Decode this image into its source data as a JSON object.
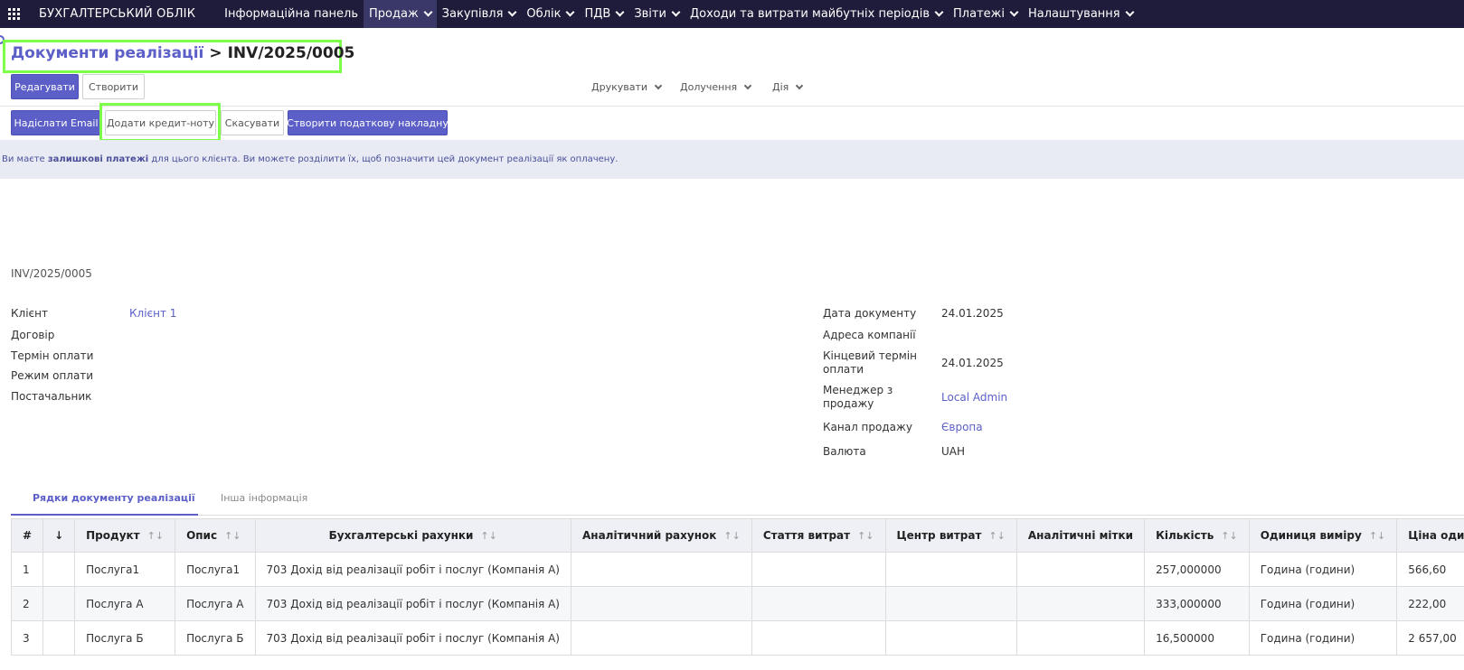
{
  "topbar": {
    "app_name": "БУХГАЛТЕРСЬКИЙ ОБЛІК",
    "items": [
      {
        "label": "Інформаційна панель",
        "dropdown": false
      },
      {
        "label": "Продаж",
        "dropdown": true,
        "active": true
      },
      {
        "label": "Закупівля",
        "dropdown": true
      },
      {
        "label": "Облік",
        "dropdown": true
      },
      {
        "label": "ПДВ",
        "dropdown": true
      },
      {
        "label": "Звіти",
        "dropdown": true
      },
      {
        "label": "Доходи та витрати майбутніх періодів",
        "dropdown": true
      },
      {
        "label": "Платежі",
        "dropdown": true
      },
      {
        "label": "Налаштування",
        "dropdown": true
      }
    ]
  },
  "breadcrumb": {
    "parent": "Документи реалізації",
    "separator": ">",
    "current": "INV/2025/0005"
  },
  "control": {
    "edit": "Редагувати",
    "create": "Створити",
    "print": "Друкувати",
    "attachments": "Долучення",
    "action": "Дія"
  },
  "statusbar": {
    "send_email": "Надіслати Email",
    "add_credit_note": "Додати кредит-ноту",
    "cancel": "Скасувати",
    "create_tax_invoice": "Створити податкову накладну"
  },
  "alert": {
    "prefix": "Ви маєте ",
    "bold": "залишкові платежі",
    "suffix": " для цього клієнта. Ви можете розділити їх, щоб позначити цей документ реалізації як оплачену."
  },
  "form": {
    "number": "INV/2025/0005",
    "left": {
      "client_label": "Клієнт",
      "client_value": "Клієнт 1",
      "contract_label": "Договір",
      "payment_terms_label": "Термін оплати",
      "payment_mode_label": "Режим оплати",
      "supplier_label": "Постачальник"
    },
    "right": {
      "doc_date_label": "Дата документу",
      "doc_date_value": "24.01.2025",
      "company_address_label": "Адреса компанії",
      "due_date_label_1": "Кінцевий термін",
      "due_date_label_2": "оплати",
      "due_date_value": "24.01.2025",
      "manager_label_1": "Менеджер з",
      "manager_label_2": "продажу",
      "manager_value": "Local Admin",
      "channel_label": "Канал продажу",
      "channel_value": "Європа",
      "currency_label": "Валюта",
      "currency_value": "UAH"
    }
  },
  "tabs": {
    "lines": "Рядки документу реалізації",
    "other": "Інша інформація"
  },
  "table": {
    "headers": {
      "num": "#",
      "sequence": "↓",
      "product": "Продукт",
      "description": "Опис",
      "accounts": "Бухгалтерські рахунки",
      "analytic_account": "Аналітичний рахунок",
      "expense_item": "Стаття витрат",
      "cost_center": "Центр витрат",
      "analytic_tags": "Аналітичні мітки",
      "quantity": "Кількість",
      "uom": "Одиниця виміру",
      "unit_price": "Ціна одиниці"
    },
    "sort_glyph": "↑↓",
    "rows": [
      {
        "num": "1",
        "product": "Послуга1",
        "description": "Послуга1",
        "account": "703 Дохід від реалізації робіт і послуг (Компанія А)",
        "qty": "257,000000",
        "uom": "Година (години)",
        "price": "566,60"
      },
      {
        "num": "2",
        "product": "Послуга А",
        "description": "Послуга А",
        "account": "703 Дохід від реалізації робіт і послуг (Компанія А)",
        "qty": "333,000000",
        "uom": "Година (години)",
        "price": "222,00"
      },
      {
        "num": "3",
        "product": "Послуга Б",
        "description": "Послуга Б",
        "account": "703 Дохід від реалізації робіт і послуг (Компанія А)",
        "qty": "16,500000",
        "uom": "Година (години)",
        "price": "2 657,00"
      }
    ]
  }
}
